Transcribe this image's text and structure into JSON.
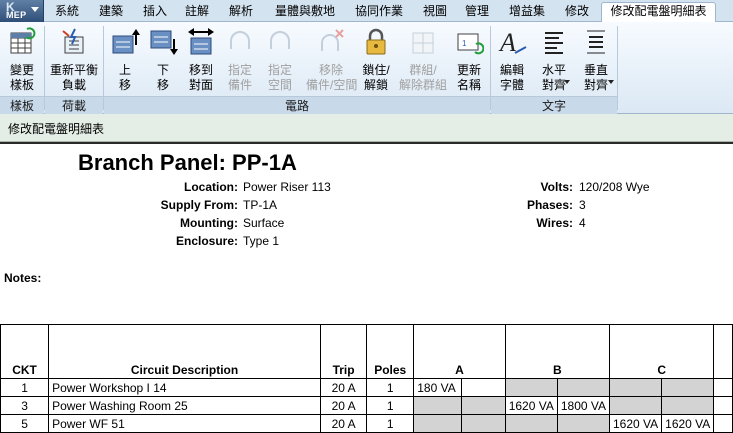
{
  "app": {
    "logo_letter": "K",
    "logo_text": "MEP"
  },
  "tabs": [
    "系統",
    "建築",
    "插入",
    "註解",
    "解析",
    "量體與敷地",
    "協同作業",
    "視圖",
    "管理",
    "增益集",
    "修改",
    "修改配電盤明細表"
  ],
  "ribbon": {
    "buttons": {
      "change_template": [
        "變更",
        "樣板"
      ],
      "rebalance": [
        "重新平衡",
        "負載"
      ],
      "move_up": [
        "上",
        "移"
      ],
      "move_down": [
        "下",
        "移"
      ],
      "move_across": [
        "移到",
        "對面"
      ],
      "assign_spare": [
        "指定",
        "備件"
      ],
      "assign_space": [
        "指定",
        "空間"
      ],
      "remove_spare": [
        "移除",
        "備件/空間"
      ],
      "lock": [
        "鎖住/",
        "解鎖"
      ],
      "group": [
        "群組/",
        "解除群組"
      ],
      "renumber": [
        "更新",
        "名稱"
      ],
      "edit_font": [
        "編輯",
        "字體"
      ],
      "align_h": [
        "水平",
        "對齊"
      ],
      "align_v": [
        "垂直",
        "對齊"
      ]
    },
    "groups": {
      "template": "樣板",
      "load": "荷載",
      "circuits": "電路",
      "text": "文字"
    }
  },
  "context_bar": "修改配電盤明細表",
  "panel": {
    "title": "Branch Panel: PP-1A",
    "fields": {
      "location_label": "Location:",
      "location": "Power Riser 113",
      "supply_label": "Supply From:",
      "supply": "TP-1A",
      "mounting_label": "Mounting:",
      "mounting": "Surface",
      "enclosure_label": "Enclosure:",
      "enclosure": "Type 1",
      "volts_label": "Volts:",
      "volts": "120/208 Wye",
      "phases_label": "Phases:",
      "phases": "3",
      "wires_label": "Wires:",
      "wires": "4"
    },
    "notes_label": "Notes:"
  },
  "schedule": {
    "headers": {
      "ckt": "CKT",
      "desc": "Circuit Description",
      "trip": "Trip",
      "poles": "Poles",
      "a": "A",
      "b": "B",
      "c": "C"
    },
    "rows": [
      {
        "ckt": "1",
        "desc": "Power Workshop I 14",
        "trip": "20 A",
        "poles": "1",
        "a1": "180 VA",
        "a2": "",
        "b1": "",
        "b2": "",
        "c1": "",
        "c2": ""
      },
      {
        "ckt": "3",
        "desc": "Power Washing Room 25",
        "trip": "20 A",
        "poles": "1",
        "a1": "",
        "a2": "",
        "b1": "1620 VA",
        "b2": "1800 VA",
        "c1": "",
        "c2": ""
      },
      {
        "ckt": "5",
        "desc": "Power WF 51",
        "trip": "20 A",
        "poles": "1",
        "a1": "",
        "a2": "",
        "b1": "",
        "b2": "",
        "c1": "1620 VA",
        "c2": "1620 VA"
      }
    ]
  }
}
